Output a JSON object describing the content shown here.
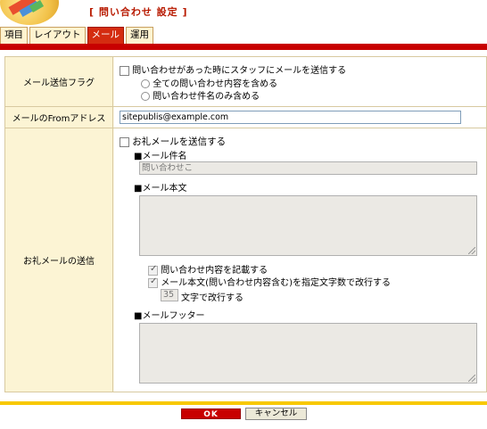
{
  "header": {
    "title": "[ 問い合わせ 設定 ]"
  },
  "tabs": [
    {
      "label": "項目"
    },
    {
      "label": "レイアウト"
    },
    {
      "label": "メール"
    },
    {
      "label": "運用"
    }
  ],
  "form": {
    "mail_flag": {
      "label": "メール送信フラグ",
      "checkbox_label": "問い合わせがあった時にスタッフにメールを送信する",
      "checked": false,
      "radio_all": "全ての問い合わせ内容を含める",
      "radio_subject": "問い合わせ件名のみ含める"
    },
    "from_address": {
      "label": "メールのFromアドレス",
      "value": "sitepublis@example.com"
    },
    "thank_you": {
      "label": "お礼メールの送信",
      "checkbox_label": "お礼メールを送信する",
      "checked": false,
      "subject_heading": "■メール件名",
      "subject_value": "問い合わせこ",
      "body_heading": "■メール本文",
      "include_content_label": "問い合わせ内容を記載する",
      "include_content_checked": true,
      "wrap_label": "メール本文(問い合わせ内容含む)を指定文字数で改行する",
      "wrap_checked": true,
      "wrap_count": "35",
      "wrap_suffix": "文字で改行する",
      "footer_heading": "■メールフッター"
    }
  },
  "buttons": {
    "ok": "OK",
    "cancel": "キャンセル"
  }
}
